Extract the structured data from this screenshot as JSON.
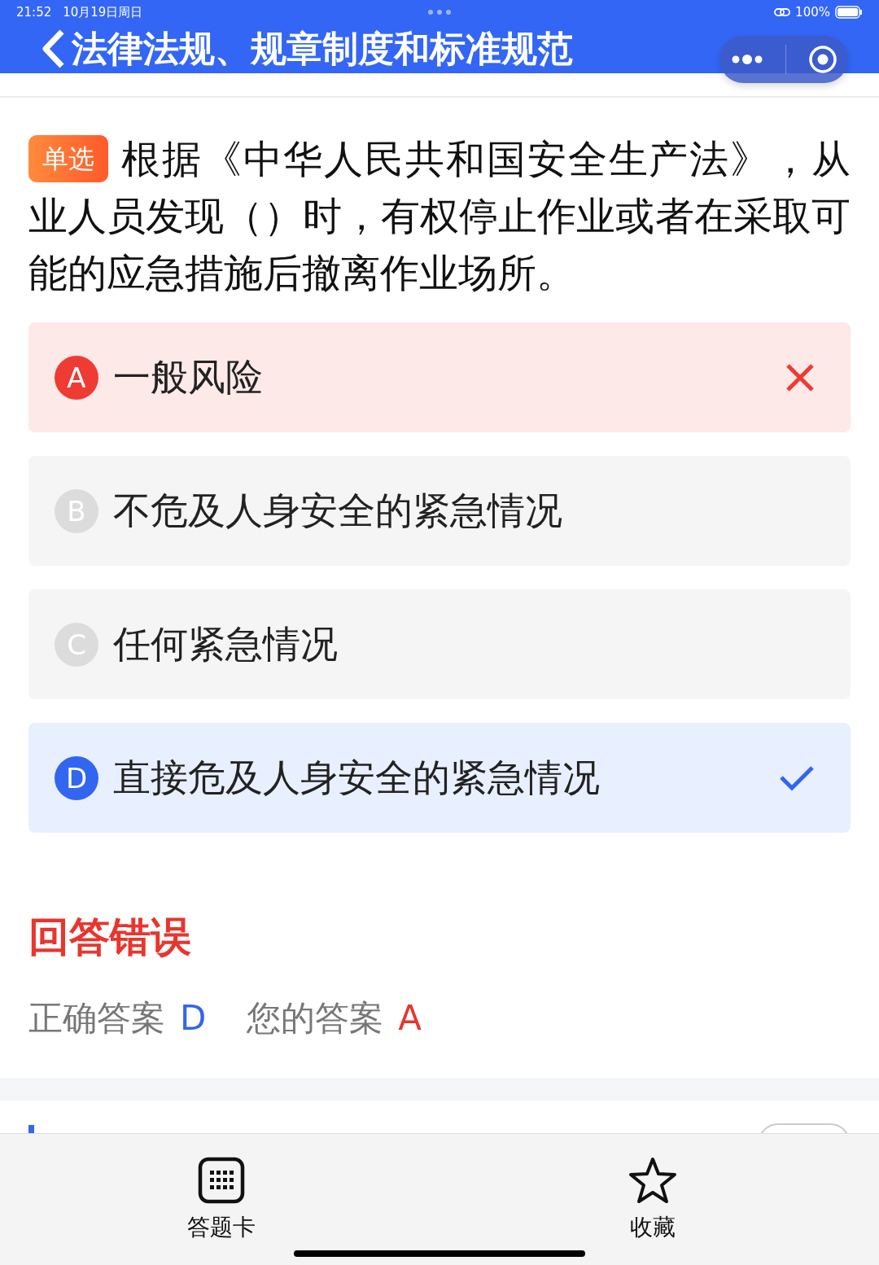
{
  "status_bar": {
    "time": "21:52",
    "date": "10月19日周日",
    "battery": "100%"
  },
  "nav": {
    "title": "法律法规、规章制度和标准规范"
  },
  "question": {
    "type_badge": "单选",
    "text": "根据《中华人民共和国安全生产法》，从业人员发现（）时，有权停止作业或者在采取可能的应急措施后撤离作业场所。"
  },
  "options": [
    {
      "letter": "A",
      "text": "一般风险",
      "selected": true,
      "is_answer": false
    },
    {
      "letter": "B",
      "text": "不危及人身安全的紧急情况",
      "selected": false,
      "is_answer": false
    },
    {
      "letter": "C",
      "text": "任何紧急情况",
      "selected": false,
      "is_answer": false
    },
    {
      "letter": "D",
      "text": "直接危及人身安全的紧急情况",
      "selected": false,
      "is_answer": true
    }
  ],
  "result": {
    "title": "回答错误",
    "correct_label": "正确答案",
    "correct_answer": "D",
    "your_label": "您的答案",
    "your_answer": "A"
  },
  "tab_bar": [
    {
      "kind": "card",
      "label": "答题卡"
    },
    {
      "kind": "star",
      "label": "收藏"
    }
  ]
}
